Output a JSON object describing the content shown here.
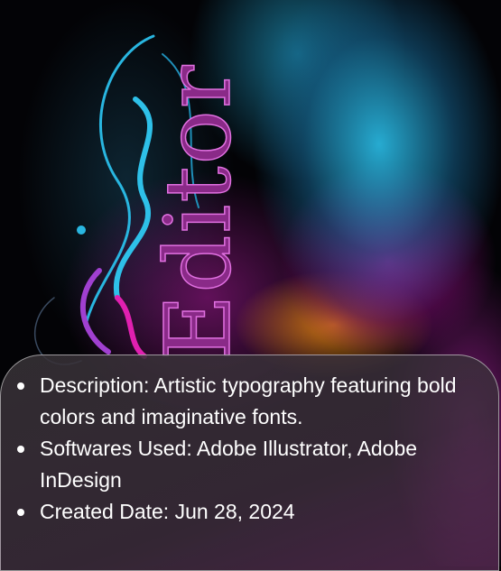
{
  "artwork": {
    "title_word": "Editor"
  },
  "details": [
    {
      "label": "Description",
      "text": "Description: Artistic typography featuring bold colors and imaginative fonts."
    },
    {
      "label": "Softwares Used",
      "text": "Softwares Used: Adobe Illustrator, Adobe InDesign"
    },
    {
      "label": "Created Date",
      "text": "Created Date: Jun 28, 2024"
    }
  ]
}
